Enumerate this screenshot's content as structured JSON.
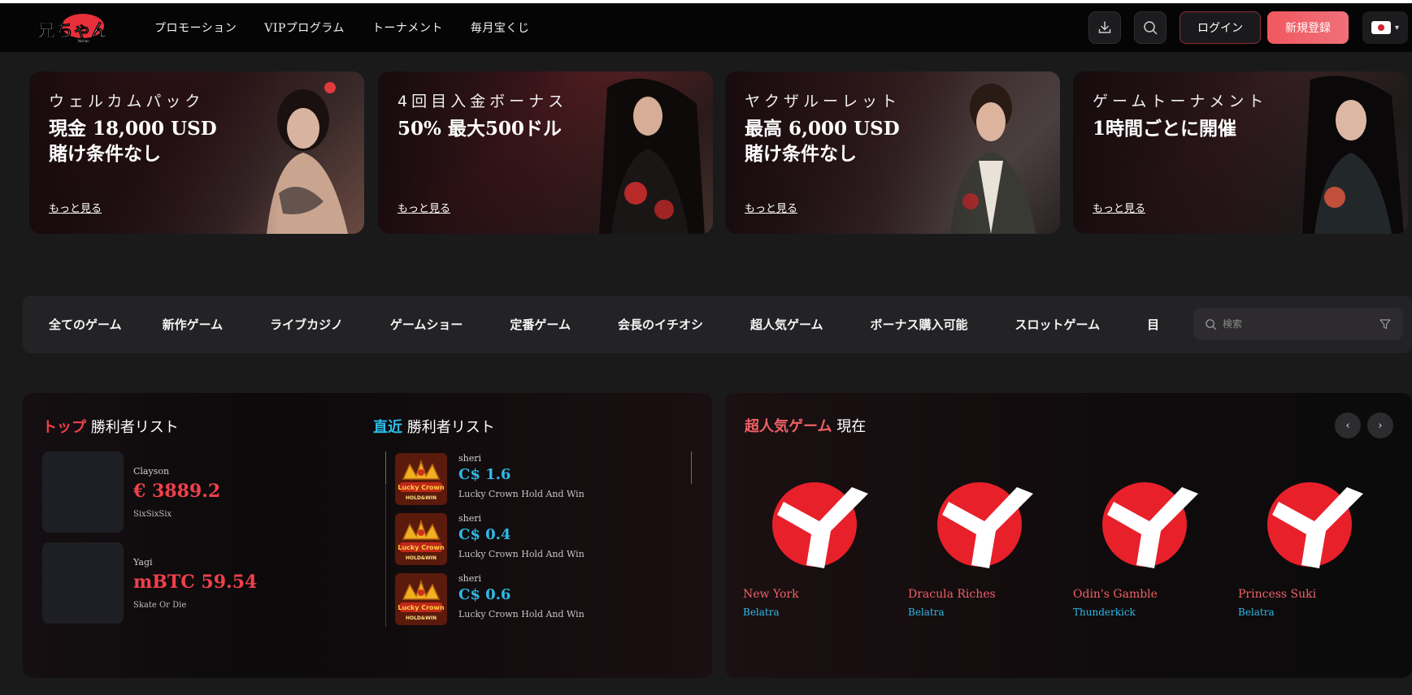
{
  "header": {
    "logo_text": "兄ちゃん",
    "nav": [
      "プロモーション",
      "VIPプログラム",
      "トーナメント",
      "毎月宝くじ"
    ],
    "icons": [
      "download-icon",
      "search-icon"
    ],
    "login_label": "ログイン",
    "register_label": "新規登録",
    "language": "jp-flag"
  },
  "banners": [
    {
      "subtitle": "ウェルカムパック",
      "title_line1": "現金 18,000 USD",
      "title_line2": "賭け条件なし",
      "more": "もっと見る"
    },
    {
      "subtitle": "4回目入金ボーナス",
      "title_line1": "50% 最大500ドル",
      "title_line2": "",
      "more": "もっと見る"
    },
    {
      "subtitle": "ヤクザルーレット",
      "title_line1": "最高 6,000 USD",
      "title_line2": "賭け条件なし",
      "more": "もっと見る"
    },
    {
      "subtitle": "ゲームトーナメント",
      "title_line1": "1時間ごとに開催",
      "title_line2": "",
      "more": "もっと見る"
    }
  ],
  "categories": {
    "items": [
      "全てのゲーム",
      "新作ゲーム",
      "ライブカジノ",
      "ゲームショー",
      "定番ゲーム",
      "会長のイチオシ",
      "超人気ゲーム",
      "ボーナス購入可能",
      "スロットゲーム",
      "目"
    ],
    "search_placeholder": "検索"
  },
  "top_winners": {
    "title_accent": "トップ",
    "title_rest": "勝利者リスト",
    "items": [
      {
        "user": "Clayson",
        "amount": "€ 3889.2",
        "game": "SixSixSix"
      },
      {
        "user": "Yagi",
        "amount": "mBTC 59.54",
        "game": "Skate Or Die"
      }
    ]
  },
  "recent_winners": {
    "title_accent": "直近",
    "title_rest": "勝利者リスト",
    "items": [
      {
        "user": "sheri",
        "amount": "C$ 1.6",
        "game": "Lucky Crown Hold And Win"
      },
      {
        "user": "sheri",
        "amount": "C$ 0.4",
        "game": "Lucky Crown Hold And Win"
      },
      {
        "user": "sheri",
        "amount": "C$ 0.6",
        "game": "Lucky Crown Hold And Win"
      }
    ],
    "thumb_text_1": "Lucky Crown",
    "thumb_text_2": "HOLD&WIN"
  },
  "popular": {
    "title_accent": "超人気ゲーム",
    "title_rest": "現在",
    "prev": "‹",
    "next": "›",
    "games": [
      {
        "name": "New York",
        "provider": "Belatra"
      },
      {
        "name": "Dracula Riches",
        "provider": "Belatra"
      },
      {
        "name": "Odin's Gamble",
        "provider": "Thunderkick"
      },
      {
        "name": "Princess Suki",
        "provider": "Belatra"
      }
    ]
  },
  "colors": {
    "accent_red": "#f0404a",
    "accent_blue": "#2dbbe8",
    "accent_coral": "#f06065",
    "register_btn": "#f0585e"
  }
}
